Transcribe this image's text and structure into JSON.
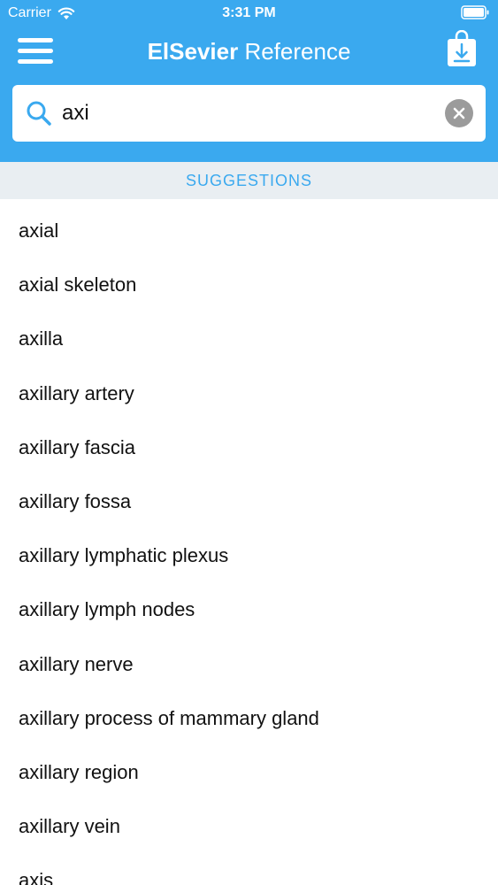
{
  "status_bar": {
    "carrier": "Carrier",
    "time": "3:31 PM"
  },
  "nav": {
    "title_brand": "ElSevier",
    "title_rest": " Reference",
    "menu_icon": "hamburger-menu-icon",
    "download_icon": "download-bag-icon"
  },
  "search": {
    "value": "axi",
    "icon": "search-icon",
    "clear_icon": "clear-icon"
  },
  "suggestions": {
    "header": "SUGGESTIONS",
    "items": [
      "axial",
      "axial skeleton",
      "axilla",
      "axillary artery",
      "axillary fascia",
      "axillary fossa",
      "axillary lymphatic plexus",
      "axillary lymph nodes",
      "axillary nerve",
      "axillary process of mammary gland",
      "axillary region",
      "axillary vein",
      "axis"
    ]
  },
  "colors": {
    "header_bg": "#3aa9ef",
    "section_bg": "#e9eef2",
    "accent": "#3aa9ef"
  }
}
